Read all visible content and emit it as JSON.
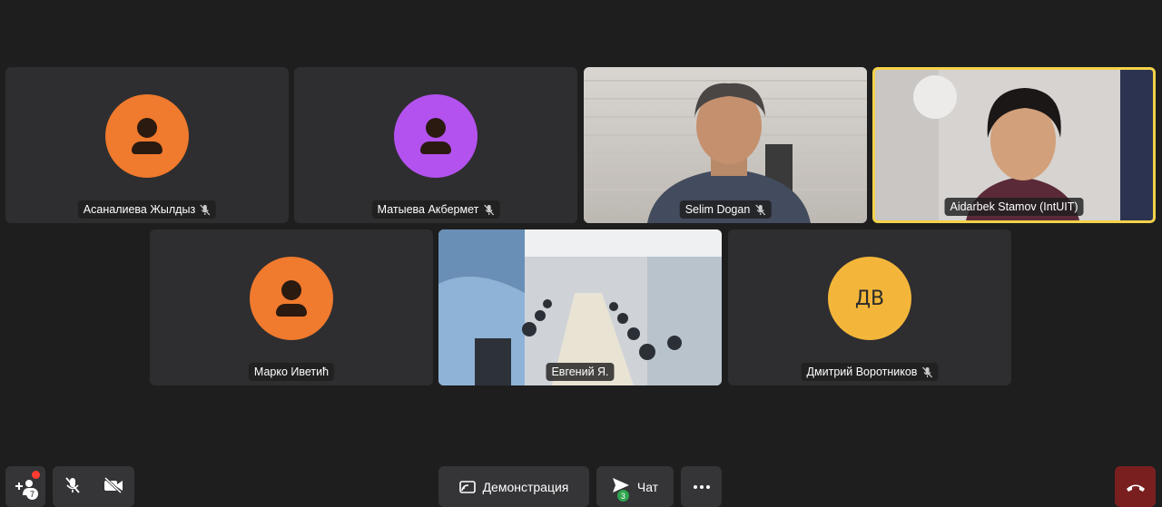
{
  "participants": [
    {
      "name": "Асаналиева Жылдыз",
      "muted": true,
      "avatar_color": "#f07a2d"
    },
    {
      "name": "Матыева Акбермет",
      "muted": true,
      "avatar_color": "#b452f0"
    },
    {
      "name": "Selim Dogan",
      "muted": true,
      "video": true
    },
    {
      "name": "Aidarbek Stamov (IntUIT)",
      "muted": false,
      "video": true,
      "active_speaker": true
    },
    {
      "name": "Марко Иветић",
      "muted": false,
      "avatar_color": "#f07a2d"
    },
    {
      "name": "Евгений Я.",
      "muted": false,
      "video": true
    },
    {
      "name": "Дмитрий Воротников",
      "muted": true,
      "avatar_color": "#f4b63a",
      "initials": "ДВ"
    }
  ],
  "toolbar": {
    "demo_label": "Демонстрация",
    "chat_label": "Чат",
    "chat_count": "3",
    "invite_count": "7"
  },
  "colors": {
    "active_border": "#f5d24a",
    "end_call": "#7a1f1f"
  }
}
